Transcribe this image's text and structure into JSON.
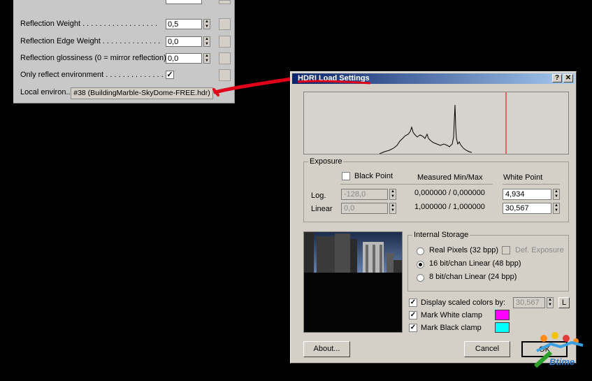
{
  "material_panel": {
    "rows": [
      {
        "label": "Reflection Weight . . . . . . . . . . . . . . . . . .",
        "value": "0,5"
      },
      {
        "label": "Reflection Edge Weight . . . . . . . . . . . . . .",
        "value": "0,0"
      },
      {
        "label": "Reflection glossiness (0 = mirror reflection) . .",
        "value": "0,0"
      }
    ],
    "only_reflect_label": "Only reflect environment . . . . . . . . . . . . . . .",
    "only_reflect_checked": "✓",
    "local_environ_label": "Local environ...",
    "local_environ_map": "#38 (BuildingMarble-SkyDome-FREE.hdr)"
  },
  "dialog": {
    "title": "HDRI Load Settings",
    "help_glyph": "?",
    "close_glyph": "✕",
    "exposure": {
      "group_title": "Exposure",
      "black_point_label": "Black Point",
      "measured_label": "Measured Min/Max",
      "white_point_label": "White Point",
      "log_label": "Log.",
      "linear_label": "Linear",
      "black_log_value": "-128,0",
      "black_linear_value": "0,0",
      "measured_log": "0,000000 / 0,000000",
      "measured_linear": "1,000000 / 1,000000",
      "white_log_value": "4,934",
      "white_linear_value": "30,567"
    },
    "storage": {
      "group_title": "Internal Storage",
      "options": [
        "Real Pixels (32 bpp)",
        "16 bit/chan Linear (48 bpp)",
        "8 bit/chan Linear (24 bpp)"
      ],
      "selected_index": 1,
      "def_exposure_label": "Def. Exposure"
    },
    "display_scaled_label": "Display scaled colors by:",
    "display_scaled_value": "30,567",
    "l_button_label": "L",
    "mark_white_label": "Mark White clamp",
    "mark_black_label": "Mark Black clamp",
    "check_glyph": "✓",
    "white_clamp_color": "#ff00ff",
    "black_clamp_color": "#00ffff",
    "about_label": "About...",
    "cancel_label": "Cancel",
    "ok_label": "OK"
  },
  "watermark": "Btime"
}
